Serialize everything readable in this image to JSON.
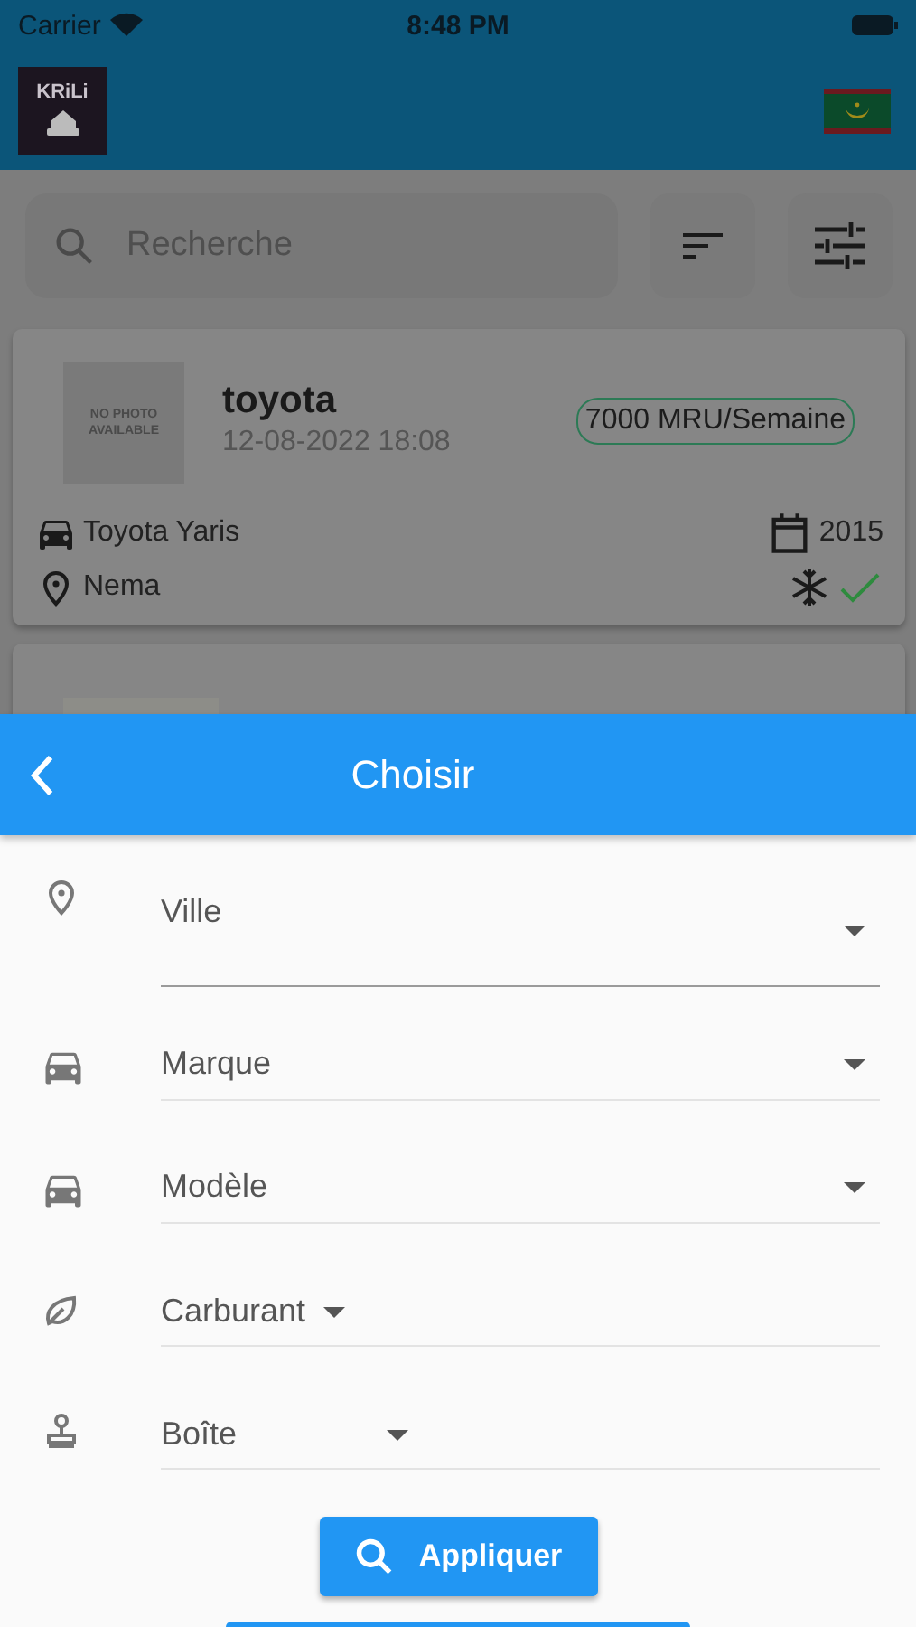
{
  "status_bar": {
    "carrier": "Carrier",
    "time": "8:48 PM"
  },
  "header": {
    "logo_text": "KRiLi"
  },
  "search": {
    "placeholder": "Recherche"
  },
  "listings": [
    {
      "kind": "placeholder",
      "photo_text": "NO PHOTO AVAILABLE",
      "title": "toyota",
      "date": "12-08-2022 18:08",
      "price": "7000 MRU/Semaine",
      "model": "Toyota Yaris",
      "city": "Nema",
      "year": "2015",
      "air_conditioning": true
    },
    {
      "kind": "picture"
    }
  ],
  "sheet": {
    "title": "Choisir",
    "fields": [
      {
        "label": "Ville",
        "kind": "tall"
      },
      {
        "label": "Marque",
        "kind": "wide"
      },
      {
        "label": "Modèle",
        "kind": "wide"
      },
      {
        "label": "Carburant",
        "kind": "hug"
      },
      {
        "label": "Boîte",
        "kind": "fixed"
      }
    ],
    "apply_button": "Appliquer"
  }
}
